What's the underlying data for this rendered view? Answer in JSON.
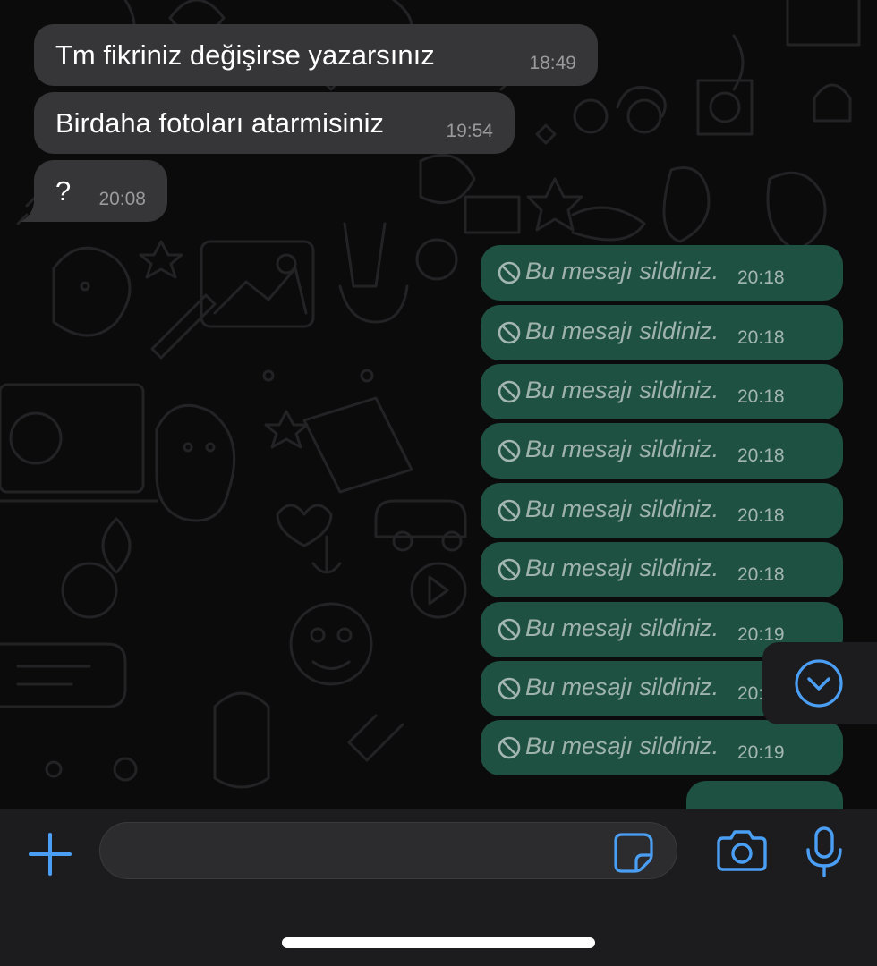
{
  "chat": {
    "incoming": [
      {
        "text": "Tm fikriniz değişirse yazarsınız",
        "time": "18:49"
      },
      {
        "text": "Birdaha fotoları atarmisiniz",
        "time": "19:54"
      },
      {
        "text": "?",
        "time": "20:08"
      }
    ],
    "outgoing": [
      {
        "text": "Bu mesajı sildiniz.",
        "time": "20:18"
      },
      {
        "text": "Bu mesajı sildiniz.",
        "time": "20:18"
      },
      {
        "text": "Bu mesajı sildiniz.",
        "time": "20:18"
      },
      {
        "text": "Bu mesajı sildiniz.",
        "time": "20:18"
      },
      {
        "text": "Bu mesajı sildiniz.",
        "time": "20:18"
      },
      {
        "text": "Bu mesajı sildiniz.",
        "time": "20:18"
      },
      {
        "text": "Bu mesajı sildiniz.",
        "time": "20:19"
      },
      {
        "text": "Bu mesajı sildiniz.",
        "time": "20:19"
      },
      {
        "text": "Bu mesajı sildiniz.",
        "time": "20:19"
      }
    ]
  },
  "composer": {
    "placeholder": "",
    "value": ""
  },
  "icons": {
    "deleted": "prohibited-icon",
    "scroll": "chevron-down-circle-icon",
    "attach": "plus-icon",
    "sticker": "sticker-icon",
    "camera": "camera-icon",
    "mic": "microphone-icon"
  },
  "colors": {
    "background": "#0b0b0c",
    "incoming_bubble": "#363638",
    "outgoing_bubble": "#1f5142",
    "accent": "#4a9ff5",
    "bar": "#1c1c1e"
  }
}
